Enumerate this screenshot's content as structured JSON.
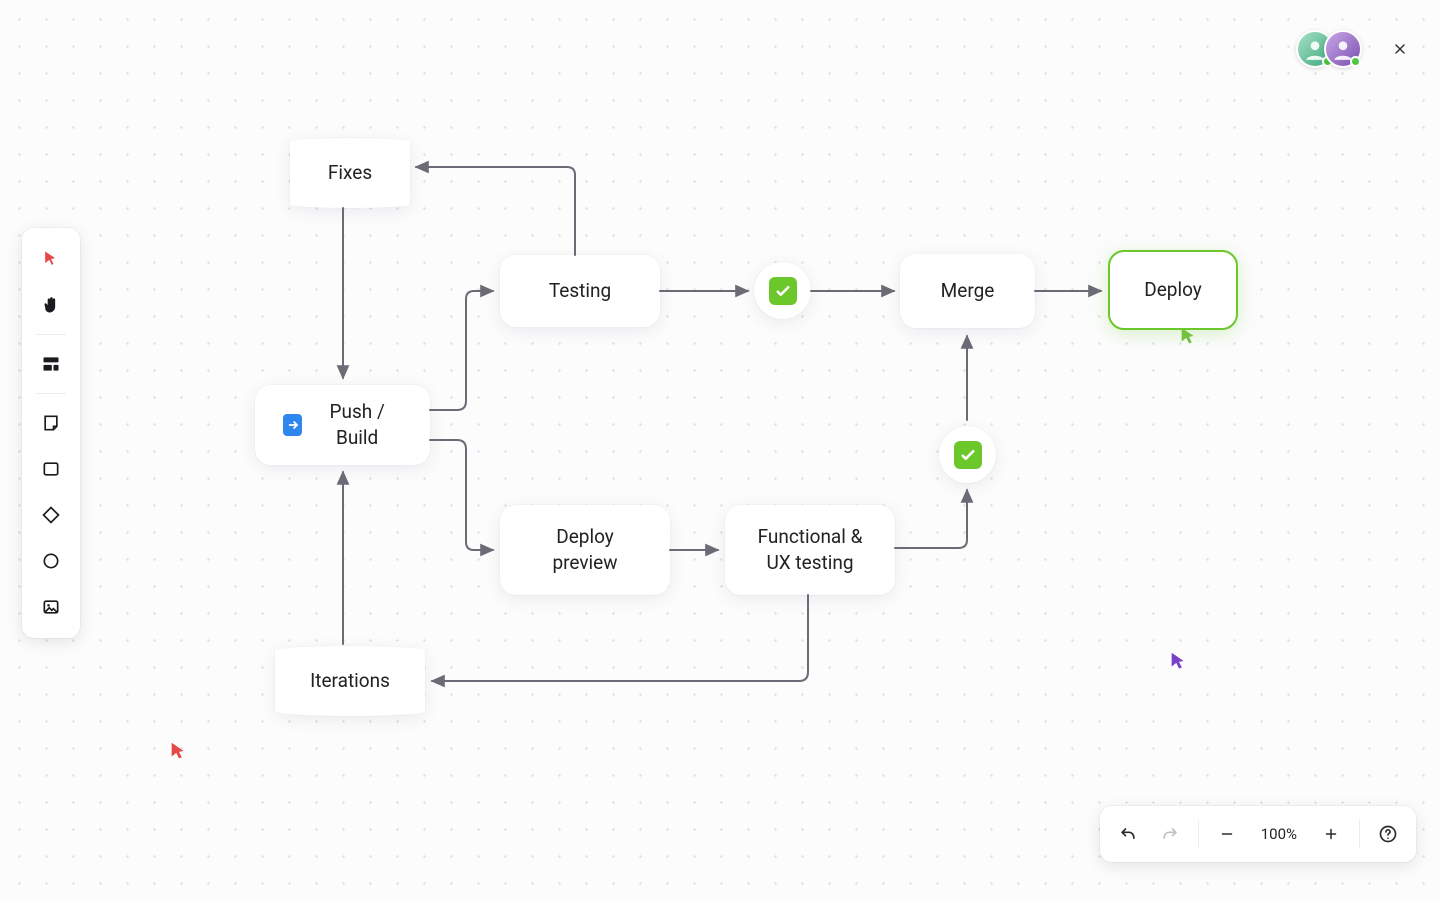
{
  "toolbar": {
    "items": [
      {
        "name": "select-tool",
        "icon": "cursor"
      },
      {
        "name": "hand-tool",
        "icon": "hand"
      },
      {
        "name": "template-tool",
        "icon": "blocks"
      },
      {
        "name": "note-tool",
        "icon": "note"
      },
      {
        "name": "rect-tool",
        "icon": "square"
      },
      {
        "name": "diamond-tool",
        "icon": "diamond"
      },
      {
        "name": "ellipse-tool",
        "icon": "circle"
      },
      {
        "name": "image-tool",
        "icon": "image"
      }
    ]
  },
  "nodes": {
    "fixes": "Fixes",
    "push_build": "Push / Build",
    "testing": "Testing",
    "deploy_preview": "Deploy\npreview",
    "functional_ux": "Functional &\nUX testing",
    "merge": "Merge",
    "deploy": "Deploy",
    "iterations": "Iterations"
  },
  "bottombar": {
    "zoom": "100%"
  },
  "colors": {
    "accent_green": "#6cc72a",
    "cursor_red": "#e64747",
    "cursor_green": "#72c23e",
    "cursor_purple": "#7b3fc9",
    "connector": "#6b6b76"
  }
}
